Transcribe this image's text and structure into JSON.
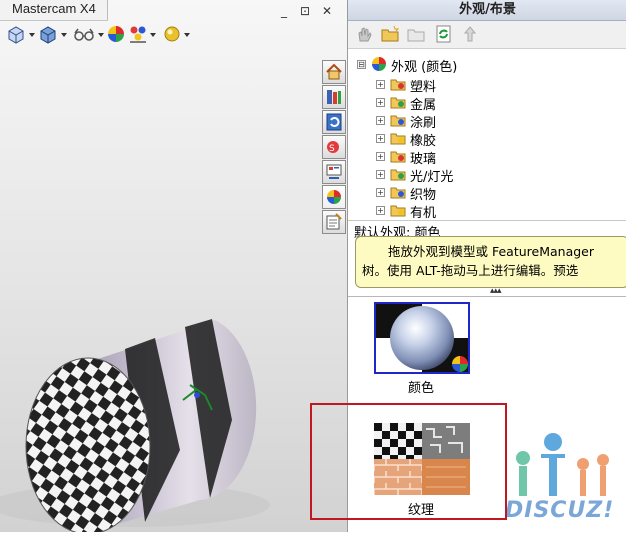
{
  "document": {
    "tab_title": "Mastercam X4",
    "window_buttons": [
      "_",
      "⊡",
      "✕"
    ]
  },
  "view_toolbar": {
    "buttons": [
      "view-orientation",
      "display-style",
      "hide-show-items",
      "edit-appearance",
      "apply-scene",
      "view-settings"
    ]
  },
  "side_tabs": [
    "home",
    "design-library",
    "file-explorer",
    "search",
    "view-palette",
    "appearances",
    "custom-properties"
  ],
  "panel": {
    "title": "外观/布景",
    "toolbar": [
      "hand-tool",
      "new-folder",
      "folder",
      "refresh",
      "up-level"
    ],
    "tree": {
      "root": "外观 (颜色)",
      "root_expander": "⊟",
      "children": [
        {
          "label": "塑料",
          "expander": "+"
        },
        {
          "label": "金属",
          "expander": "+"
        },
        {
          "label": "涂刷",
          "expander": "+"
        },
        {
          "label": "橡胶",
          "expander": "+"
        },
        {
          "label": "玻璃",
          "expander": "+"
        },
        {
          "label": "光/灯光",
          "expander": "+"
        },
        {
          "label": "织物",
          "expander": "+"
        },
        {
          "label": "有机",
          "expander": "+"
        }
      ]
    },
    "default_label": "默认外观: 颜色",
    "tooltip": {
      "line1": "拖放外观到模型或 FeatureManager",
      "line2": "树。使用 ALT-拖动马上进行编辑。预选"
    },
    "splitter": "▴▴▴",
    "items": [
      {
        "label": "颜色",
        "selected": true
      },
      {
        "label": "纹理",
        "selected": false
      }
    ]
  },
  "watermark": "DISCUZ!",
  "colors": {
    "selection_border": "#1f27c8",
    "highlight_box": "#c0181e",
    "tooltip_bg": "#fdfbc1"
  }
}
